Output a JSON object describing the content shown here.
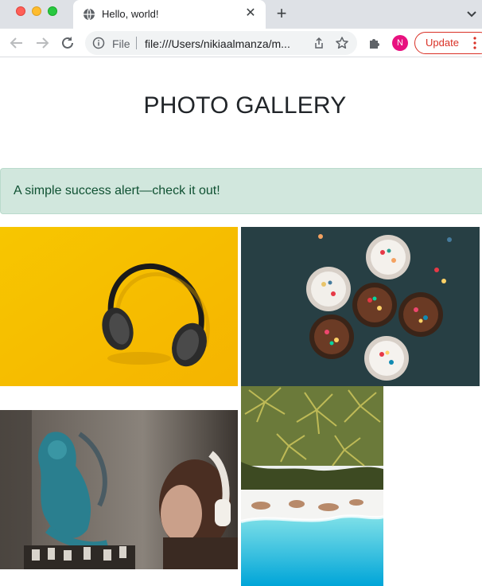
{
  "window": {
    "tab_title": "Hello, world!",
    "close_glyph": "✕",
    "new_tab_glyph": "+"
  },
  "toolbar": {
    "scheme_label": "File",
    "url": "file:///Users/nikiaalmanza/m...",
    "profile_initial": "N",
    "update_label": "Update"
  },
  "page": {
    "title": "PHOTO GALLERY",
    "alert": "A simple success alert—check it out!"
  },
  "gallery": {
    "photos": [
      {
        "subject": "headphones-on-yellow"
      },
      {
        "subject": "cupcakes-with-sprinkles"
      },
      {
        "subject": "graffiti-mermaid-with-headphones"
      },
      {
        "subject": "palm-trees-beach-aerial"
      }
    ]
  },
  "colors": {
    "alert_bg": "#d1e7dd",
    "alert_text": "#0f5132",
    "update_accent": "#d93025",
    "avatar_bg": "#e8117f"
  },
  "icons": [
    "globe-icon",
    "close-icon",
    "plus-icon",
    "chevron-down-icon",
    "back-icon",
    "forward-icon",
    "reload-icon",
    "info-icon",
    "share-icon",
    "star-icon",
    "puzzle-icon",
    "more-vert-icon"
  ]
}
